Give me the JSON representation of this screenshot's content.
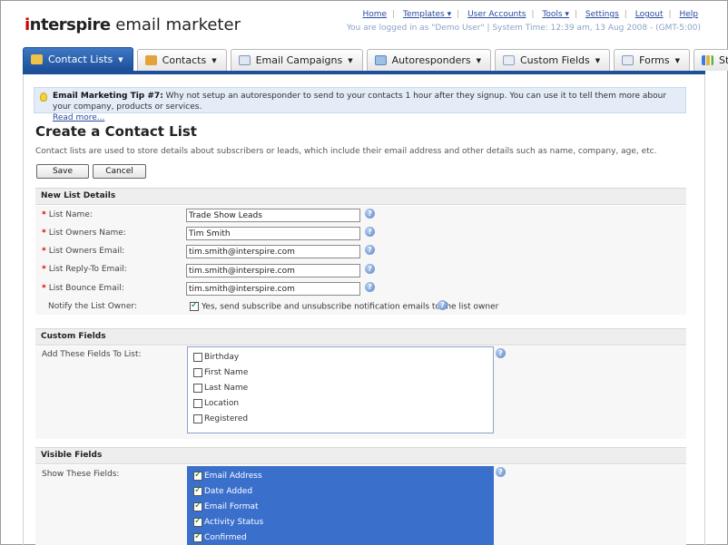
{
  "header": {
    "logo_prefix": "interspire",
    "logo_suffix": " email marketer",
    "links": [
      "Home",
      "Templates",
      "User Accounts",
      "Tools",
      "Settings",
      "Logout",
      "Help"
    ],
    "user_info": "You are logged in as \"Demo User\" | System Time: 12:39 am, 13 Aug 2008 - (GMT-5:00)"
  },
  "tabs": [
    {
      "label": "Contact Lists",
      "icon": "contact-lists-icon",
      "active": true
    },
    {
      "label": "Contacts",
      "icon": "contacts-icon"
    },
    {
      "label": "Email Campaigns",
      "icon": "email-campaigns-icon"
    },
    {
      "label": "Autoresponders",
      "icon": "autoresponders-icon"
    },
    {
      "label": "Custom Fields",
      "icon": "custom-fields-icon"
    },
    {
      "label": "Forms",
      "icon": "forms-icon"
    },
    {
      "label": "Stats",
      "icon": "stats-icon"
    }
  ],
  "tip": {
    "title": "Email Marketing Tip #7:",
    "text": " Why not setup an autoresponder to send to your contacts 1 hour after they signup. You can use it to tell them more abour your company, products or services.",
    "link": "Read more..."
  },
  "page": {
    "title": "Create a Contact List",
    "intro": "Contact lists are used to store details about subscribers or leads, which include their email address and other details such as name, company, age, etc.",
    "save": "Save",
    "cancel": "Cancel"
  },
  "new_list": {
    "heading": "New List Details",
    "fields": [
      {
        "label": "List Name:",
        "value": "Trade Show Leads"
      },
      {
        "label": "List Owners Name:",
        "value": "Tim Smith"
      },
      {
        "label": "List Owners Email:",
        "value": "tim.smith@interspire.com"
      },
      {
        "label": "List Reply-To Email:",
        "value": "tim.smith@interspire.com"
      },
      {
        "label": "List Bounce Email:",
        "value": "tim.smith@interspire.com"
      }
    ],
    "notify_label": "Notify the List Owner:",
    "notify_text": "Yes, send subscribe and unsubscribe notification emails to the list owner",
    "notify_checked": true
  },
  "custom_fields": {
    "heading": "Custom Fields",
    "label": "Add These Fields To List:",
    "items": [
      "Birthday",
      "First Name",
      "Last Name",
      "Location",
      "Registered"
    ]
  },
  "visible_fields": {
    "heading": "Visible Fields",
    "label": "Show These Fields:",
    "items": [
      "Email Address",
      "Date Added",
      "Email Format",
      "Activity Status",
      "Confirmed"
    ]
  },
  "colors": {
    "tab_active": "#1d4f9a",
    "link": "#2a4aa0",
    "selected_list": "#3a6fcc",
    "required": "#dd0000"
  }
}
